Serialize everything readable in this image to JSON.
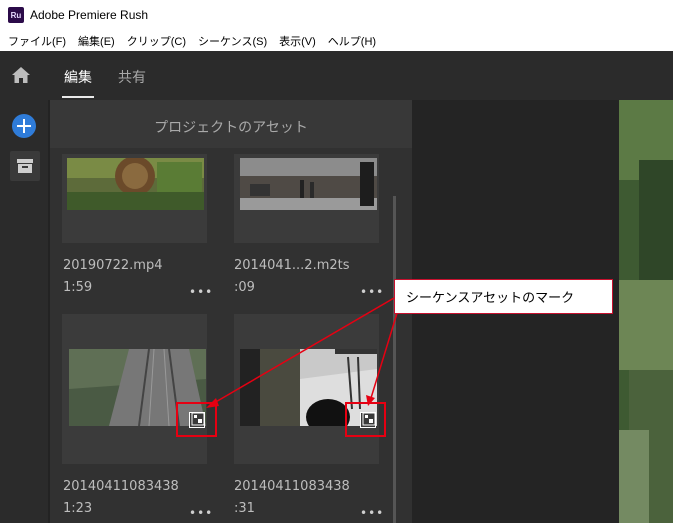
{
  "window": {
    "app_icon_text": "Ru",
    "title": "Adobe Premiere Rush"
  },
  "menu": [
    "ファイル(F)",
    "編集(E)",
    "クリップ(C)",
    "シーケンス(S)",
    "表示(V)",
    "ヘルプ(H)"
  ],
  "tabs": {
    "edit": "編集",
    "share": "共有"
  },
  "panel": {
    "title": "プロジェクトのアセット"
  },
  "assets": [
    {
      "name": "20190722.mp4",
      "duration": "1:59",
      "more": "•••"
    },
    {
      "name": "2014041...2.m2ts",
      "duration": ":09",
      "more": "•••"
    },
    {
      "name": "20140411083438",
      "duration": "1:23",
      "more": "•••",
      "sequence": true
    },
    {
      "name": "20140411083438",
      "duration": ":31",
      "more": "•••",
      "sequence": true
    }
  ],
  "annotation": {
    "callout": "シーケンスアセットのマーク",
    "color": "#e60012"
  },
  "colors": {
    "accent": "#2f7cd9",
    "panel": "#313131",
    "card": "#3b3b3b"
  }
}
